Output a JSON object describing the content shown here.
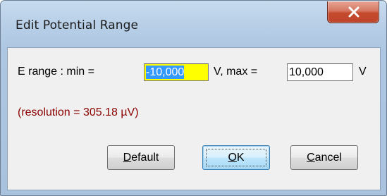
{
  "window": {
    "title": "Edit Potential Range",
    "close_glyph": "X"
  },
  "range": {
    "label_prefix": "E range : min =",
    "min_value": "-10,000",
    "unit_min": "V, max =",
    "max_value": "10,000",
    "unit_max": "V"
  },
  "resolution_text": "(resolution = 305.18 µV)",
  "buttons": {
    "default": {
      "first": "D",
      "rest": "efault"
    },
    "ok": {
      "first": "O",
      "rest": "K"
    },
    "cancel": {
      "first": "C",
      "rest": "ancel"
    }
  },
  "colors": {
    "title_bar": "#b6cde6",
    "close_button": "#c44a2d",
    "selection": "#3399ff",
    "min_field_highlight": "#ffff00",
    "resolution_text": "#8b0000"
  },
  "icons": {
    "close": "close-icon"
  }
}
